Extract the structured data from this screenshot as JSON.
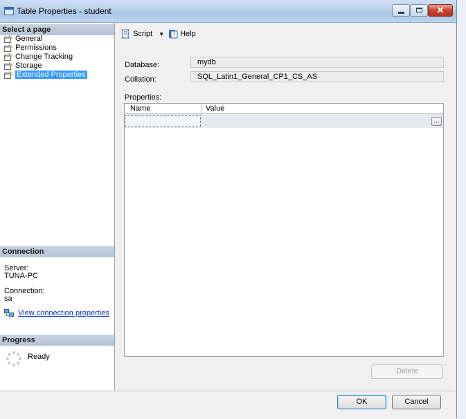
{
  "window": {
    "title": "Table Properties - student"
  },
  "left_pane": {
    "select_page_header": "Select a page",
    "pages": [
      {
        "label": "General",
        "selected": false
      },
      {
        "label": "Permissions",
        "selected": false
      },
      {
        "label": "Change Tracking",
        "selected": false
      },
      {
        "label": "Storage",
        "selected": false
      },
      {
        "label": "Extended Properties",
        "selected": true
      }
    ],
    "connection_header": "Connection",
    "server_label": "Server:",
    "server_value": "TUNA-PC",
    "connection_label": "Connection:",
    "connection_value": "sa",
    "view_connection_link": "View connection properties",
    "progress_header": "Progress",
    "progress_status": "Ready"
  },
  "toolbar": {
    "script_label": "Script",
    "help_label": "Help"
  },
  "form": {
    "database_label": "Database:",
    "database_value": "mydb",
    "collation_label": "Collation:",
    "collation_value": "SQL_Latin1_General_CP1_CS_AS",
    "properties_label": "Properties:"
  },
  "grid": {
    "columns": [
      "Name",
      "Value"
    ],
    "rows": [
      {
        "name": "",
        "value": "",
        "ellipsis": "..."
      }
    ]
  },
  "buttons": {
    "delete": "Delete",
    "ok": "OK",
    "cancel": "Cancel"
  }
}
